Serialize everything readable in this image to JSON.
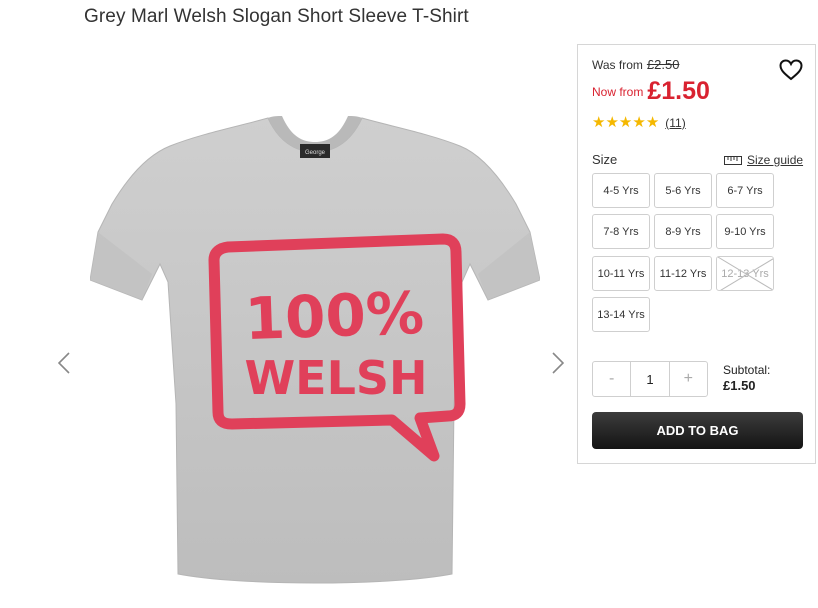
{
  "product": {
    "title": "Grey Marl Welsh Slogan Short Sleeve T-Shirt",
    "print_line1": "100%",
    "print_line2": "WELSH",
    "neck_label": "George"
  },
  "pricing": {
    "was_label": "Was from",
    "was_price": "£2.50",
    "now_label": "Now from",
    "now_price": "£1.50"
  },
  "rating": {
    "stars": 5,
    "review_count": "(11)"
  },
  "size": {
    "label": "Size",
    "guide_label": "Size guide",
    "options": [
      {
        "label": "4-5 Yrs",
        "available": true
      },
      {
        "label": "5-6 Yrs",
        "available": true
      },
      {
        "label": "6-7 Yrs",
        "available": true
      },
      {
        "label": "7-8 Yrs",
        "available": true
      },
      {
        "label": "8-9 Yrs",
        "available": true
      },
      {
        "label": "9-10 Yrs",
        "available": true
      },
      {
        "label": "10-11 Yrs",
        "available": true
      },
      {
        "label": "11-12 Yrs",
        "available": true
      },
      {
        "label": "12-13 Yrs",
        "available": false
      },
      {
        "label": "13-14 Yrs",
        "available": true
      }
    ]
  },
  "quantity": {
    "minus": "-",
    "value": "1",
    "plus": "+"
  },
  "subtotal": {
    "label": "Subtotal:",
    "amount": "£1.50"
  },
  "actions": {
    "add_to_bag": "ADD TO BAG"
  },
  "colors": {
    "sale_red": "#d92230",
    "star_yellow": "#f5b800",
    "shirt_grey": "#c9c9c9",
    "print_red": "#e0405a"
  },
  "icons": {
    "heart": "heart-icon",
    "ruler": "ruler-icon",
    "prev": "chevron-left-icon",
    "next": "chevron-right-icon"
  }
}
